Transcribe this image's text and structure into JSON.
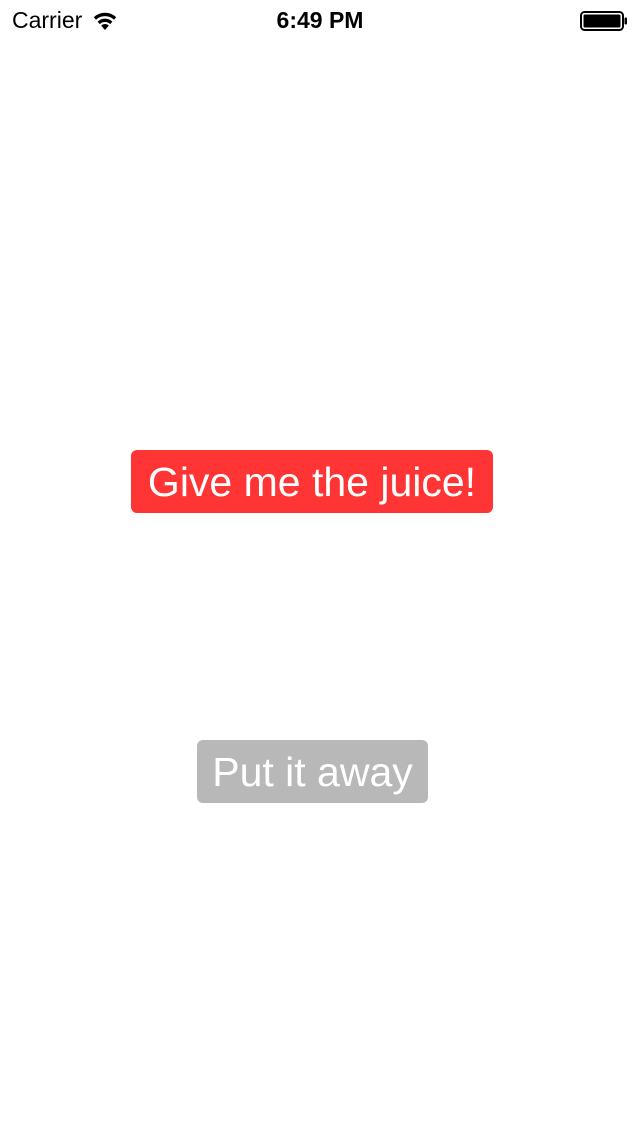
{
  "status_bar": {
    "carrier": "Carrier",
    "time": "6:49 PM",
    "wifi_icon": "wifi-icon",
    "battery_icon": "battery-full-icon"
  },
  "buttons": {
    "primary": {
      "label": "Give me the juice!",
      "background": "#ff3434"
    },
    "secondary": {
      "label": "Put it away",
      "background": "#b8b8b8"
    }
  },
  "colors": {
    "background": "#ffffff",
    "text": "#000000",
    "button_text": "#ffffff"
  }
}
